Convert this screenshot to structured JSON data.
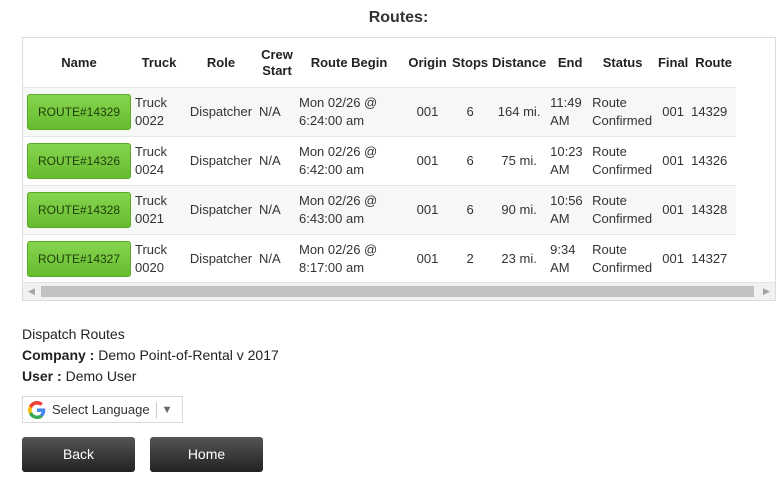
{
  "page": {
    "title": "Routes:"
  },
  "table": {
    "headers": [
      {
        "key": "name",
        "label": "Name"
      },
      {
        "key": "truck",
        "label": "Truck"
      },
      {
        "key": "role",
        "label": "Role"
      },
      {
        "key": "crew",
        "label": "Crew Start"
      },
      {
        "key": "begin",
        "label": "Route Begin"
      },
      {
        "key": "origin",
        "label": "Origin"
      },
      {
        "key": "stops",
        "label": "Stops"
      },
      {
        "key": "distance",
        "label": "Distance"
      },
      {
        "key": "end",
        "label": "End"
      },
      {
        "key": "status",
        "label": "Status"
      },
      {
        "key": "final",
        "label": "Final"
      },
      {
        "key": "route",
        "label": "Route"
      }
    ],
    "rows": [
      {
        "name": "ROUTE#14329",
        "truck": "Truck 0022",
        "role": "Dispatcher",
        "crew": "N/A",
        "begin": "Mon 02/26 @ 6:24:00 am",
        "origin": "001",
        "stops": "6",
        "distance": "164 mi.",
        "end": "11:49 AM",
        "status": "Route Confirmed",
        "final": "001",
        "route": "14329"
      },
      {
        "name": "ROUTE#14326",
        "truck": "Truck 0024",
        "role": "Dispatcher",
        "crew": "N/A",
        "begin": "Mon 02/26 @ 6:42:00 am",
        "origin": "001",
        "stops": "6",
        "distance": "75 mi.",
        "end": "10:23 AM",
        "status": "Route Confirmed",
        "final": "001",
        "route": "14326"
      },
      {
        "name": "ROUTE#14328",
        "truck": "Truck 0021",
        "role": "Dispatcher",
        "crew": "N/A",
        "begin": "Mon 02/26 @ 6:43:00 am",
        "origin": "001",
        "stops": "6",
        "distance": "90 mi.",
        "end": "10:56 AM",
        "status": "Route Confirmed",
        "final": "001",
        "route": "14328"
      },
      {
        "name": "ROUTE#14327",
        "truck": "Truck 0020",
        "role": "Dispatcher",
        "crew": "N/A",
        "begin": "Mon 02/26 @ 8:17:00 am",
        "origin": "001",
        "stops": "2",
        "distance": "23 mi.",
        "end": "9:34 AM",
        "status": "Route Confirmed",
        "final": "001",
        "route": "14327"
      }
    ]
  },
  "info": {
    "section": "Dispatch Routes",
    "company_label": "Company :",
    "company": "Demo Point-of-Rental v 2017",
    "user_label": "User :",
    "user": "Demo User"
  },
  "language": {
    "label": "Select Language",
    "icon": "google-icon"
  },
  "buttons": {
    "back": "Back",
    "home": "Home"
  },
  "colors": {
    "route_button": "#6cc234",
    "nav_button": "#333333"
  }
}
